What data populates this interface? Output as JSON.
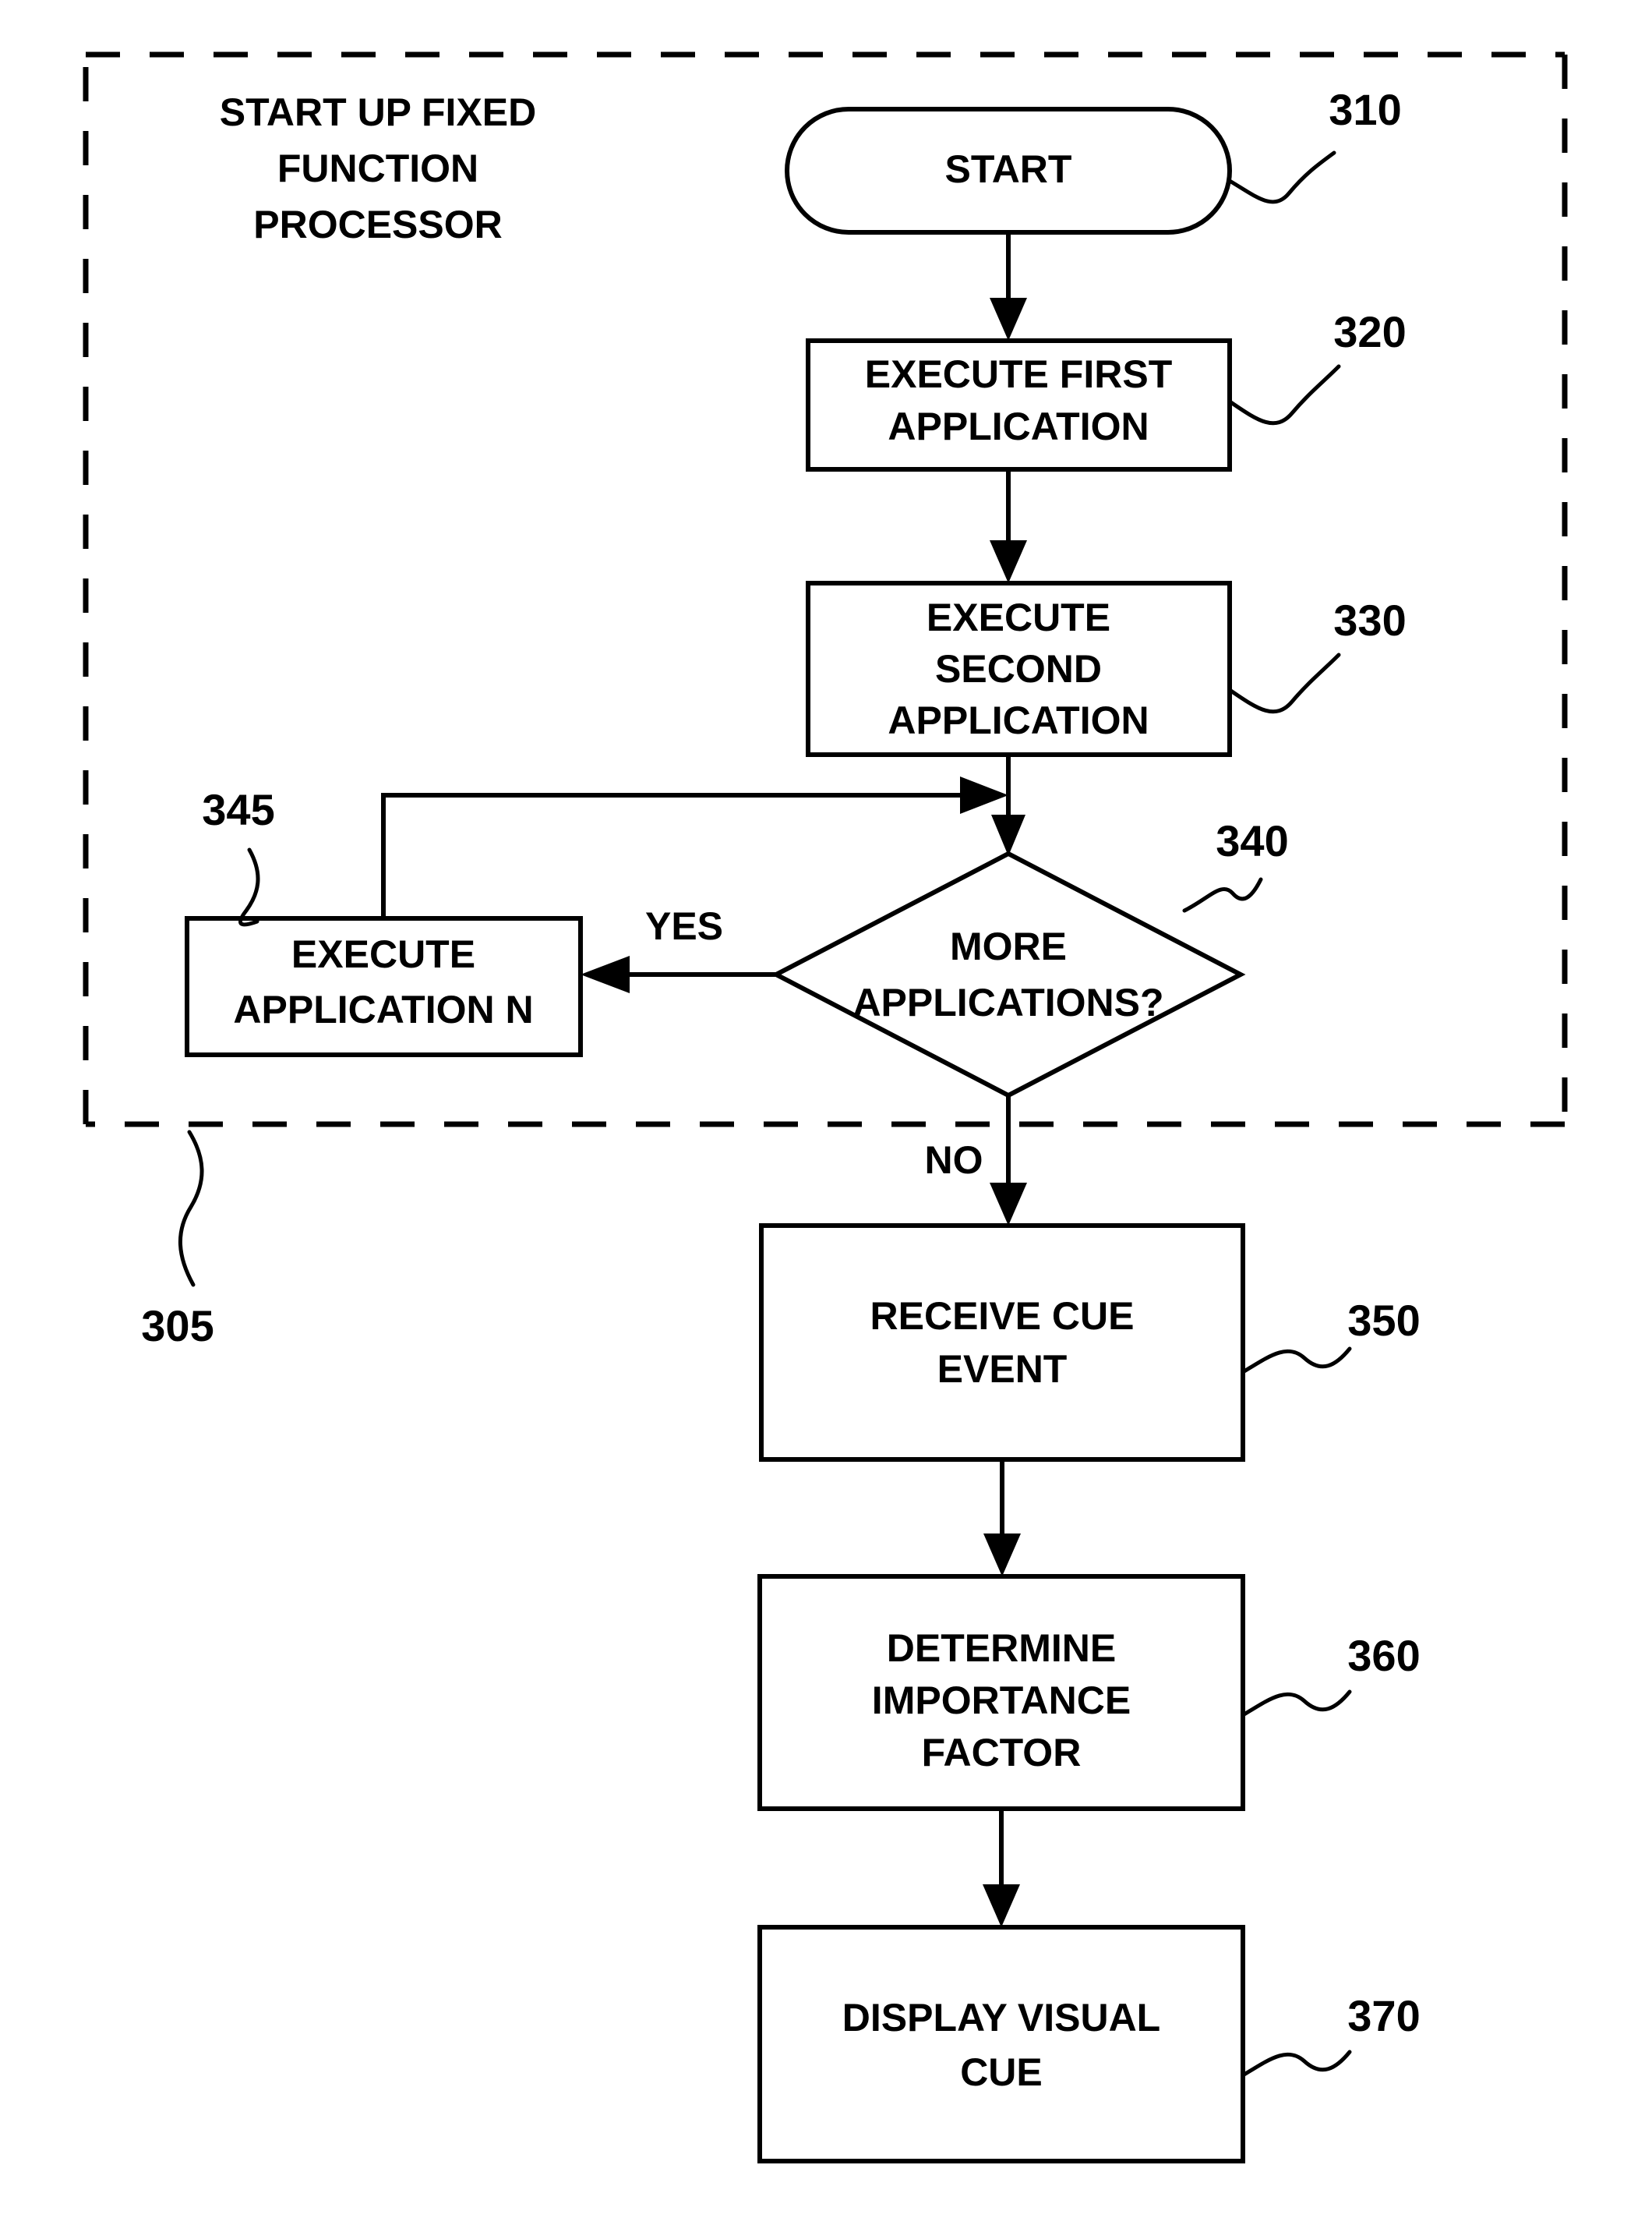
{
  "figure": {
    "group_label": {
      "lines": [
        "START UP FIXED",
        "FUNCTION",
        "PROCESSOR"
      ],
      "ref": "305"
    },
    "nodes": {
      "start": {
        "label": "START",
        "ref": "310",
        "shape": "terminator"
      },
      "execute_first": {
        "lines": [
          "EXECUTE FIRST",
          "APPLICATION"
        ],
        "ref": "320",
        "shape": "process"
      },
      "execute_second": {
        "lines": [
          "EXECUTE",
          "SECOND",
          "APPLICATION"
        ],
        "ref": "330",
        "shape": "process"
      },
      "more_applications": {
        "lines": [
          "MORE",
          "APPLICATIONS?"
        ],
        "ref": "340",
        "shape": "decision"
      },
      "execute_app_n": {
        "lines": [
          "EXECUTE",
          "APPLICATION N"
        ],
        "ref": "345",
        "shape": "process"
      },
      "receive_cue_event": {
        "lines": [
          "RECEIVE CUE",
          "EVENT"
        ],
        "ref": "350",
        "shape": "process"
      },
      "determine_importance": {
        "lines": [
          "DETERMINE",
          "IMPORTANCE",
          "FACTOR"
        ],
        "ref": "360",
        "shape": "process"
      },
      "display_visual_cue": {
        "lines": [
          "DISPLAY VISUAL",
          "CUE"
        ],
        "ref": "370",
        "shape": "process"
      }
    },
    "edge_labels": {
      "yes": "YES",
      "no": "NO"
    },
    "colors": {
      "stroke": "#000000",
      "fill": "#ffffff"
    }
  }
}
